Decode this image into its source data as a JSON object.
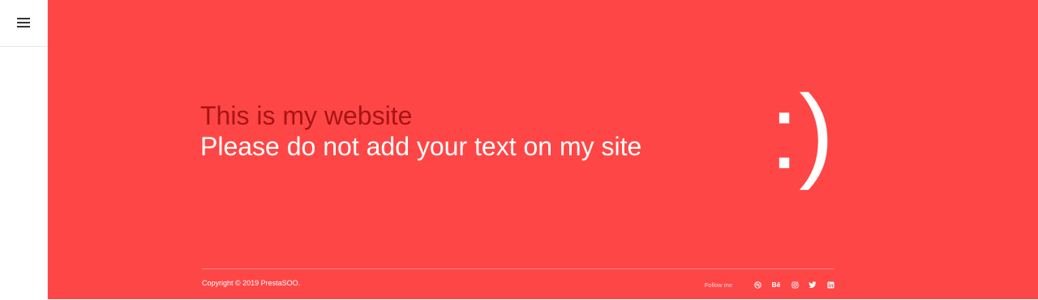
{
  "headline": {
    "line1": "This is my website",
    "line2": "Please do not add your text on my site",
    "line1_color": "#a81414",
    "line2_color": "#ffffff"
  },
  "smiley": ":)",
  "footer": {
    "copyright": "Copyright © 2019 PrestaSOO.",
    "follow_label": "Follow me",
    "social_icons": [
      "dribbble-icon",
      "behance-icon",
      "instagram-icon",
      "twitter-icon",
      "linkedin-icon"
    ],
    "behance_text": "Bē"
  },
  "colors": {
    "accent": "#ff4646",
    "sidebar": "#ffffff"
  }
}
